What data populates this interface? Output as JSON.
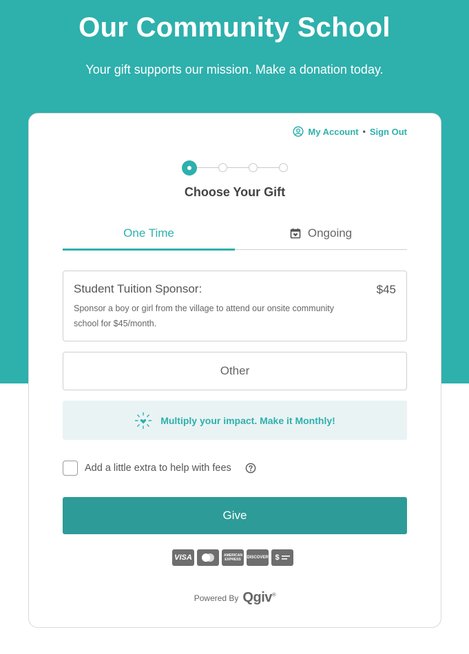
{
  "header": {
    "title": "Our Community School",
    "subtitle": "Your gift supports our mission. Make a donation today."
  },
  "account": {
    "icon": "user-circle-icon",
    "my_account": "My Account",
    "separator": "•",
    "sign_out": "Sign Out"
  },
  "stepper": {
    "current_step": 1,
    "total_steps": 4,
    "title": "Choose Your Gift"
  },
  "tabs": [
    {
      "label": "One Time",
      "active": true,
      "icon": ""
    },
    {
      "label": "Ongoing",
      "active": false,
      "icon": "calendar-heart-icon"
    }
  ],
  "gift": {
    "name": "Student Tuition Sponsor:",
    "amount": "$45",
    "description": "Sponsor a boy or girl from the village to attend our onsite community school for $45/month."
  },
  "other": {
    "label": "Other"
  },
  "monthly_banner": {
    "icon": "sparkle-heart-icon",
    "text": "Multiply your impact. Make it Monthly!"
  },
  "fees": {
    "label": "Add a little extra to help with fees",
    "checked": false,
    "help_icon": "question-circle-icon"
  },
  "give_button": {
    "label": "Give"
  },
  "payment_methods": [
    {
      "icon": "visa-icon",
      "text": "VISA"
    },
    {
      "icon": "mastercard-icon",
      "text": ""
    },
    {
      "icon": "amex-icon",
      "text": "AMERICAN EXPRESS"
    },
    {
      "icon": "discover-icon",
      "text": "DISCOVER"
    },
    {
      "icon": "bank-check-icon",
      "text": "$"
    }
  ],
  "footer": {
    "powered_by": "Powered By",
    "brand": "Qgiv",
    "registered": "®"
  },
  "colors": {
    "accent": "#2eb0ad",
    "button": "#2d9b98",
    "banner_bg": "#eaf3f4"
  }
}
